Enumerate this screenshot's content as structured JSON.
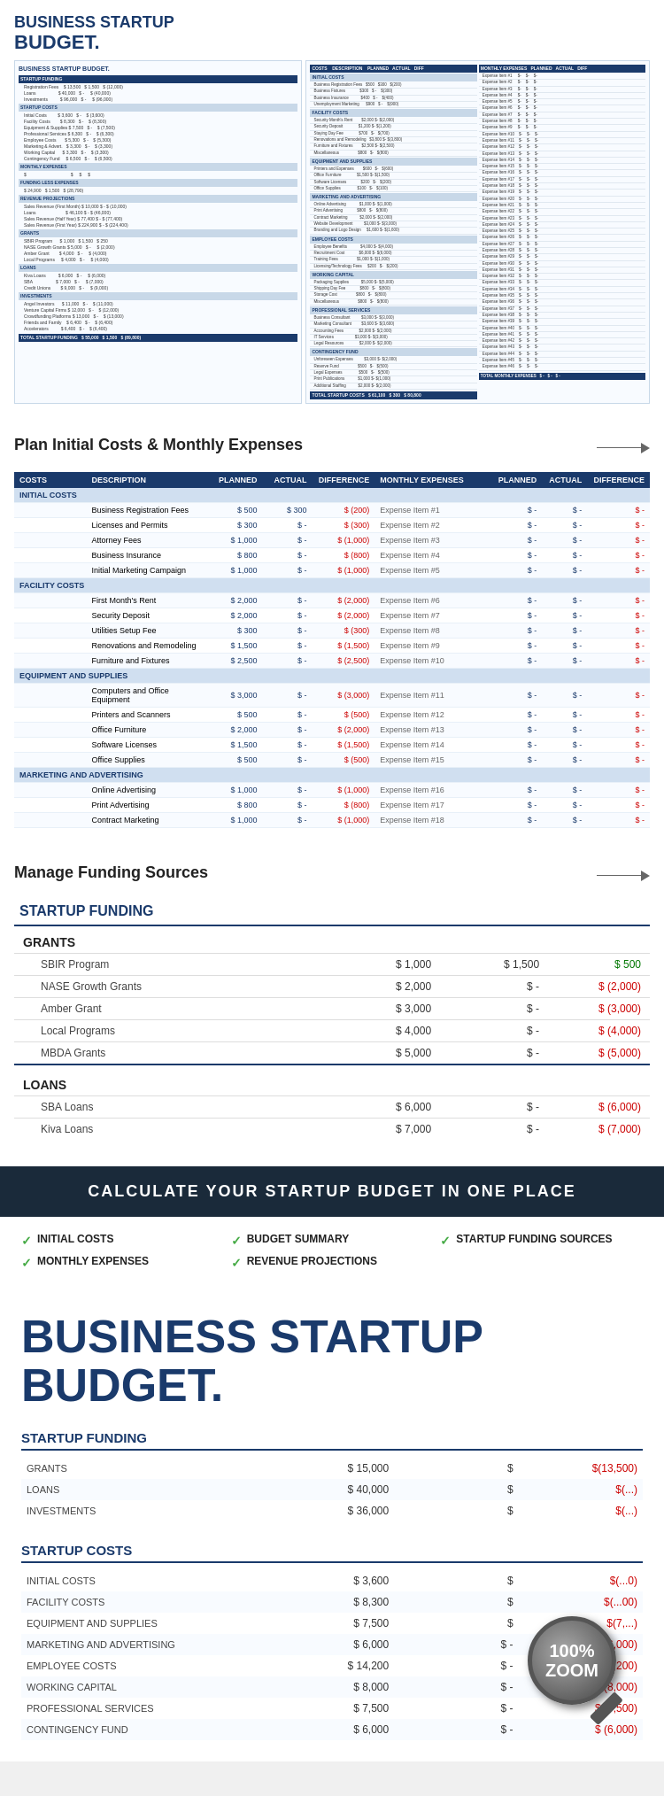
{
  "header": {
    "title": "BUSINESS STARTUP",
    "title2": "BUDGET."
  },
  "transition1": {
    "text": "Plan Initial Costs & Monthly Expenses"
  },
  "transition2": {
    "text": "Manage Funding Sources"
  },
  "banner": {
    "text": "CALCULATE YOUR STARTUP BUDGET IN ONE PLACE"
  },
  "features": [
    {
      "label": "INITIAL COSTS"
    },
    {
      "label": "MONTHLY EXPENSES"
    },
    {
      "label": "BUDGET SUMMARY"
    },
    {
      "label": "REVENUE PROJECTIONS"
    },
    {
      "label": "STARTUP FUNDING SOURCES"
    }
  ],
  "spreadsheet": {
    "sections": {
      "startup_funding": "STARTUP FUNDING",
      "startup_costs": "STARTUP COSTS",
      "monthly_expenses": "MONTHLY EXPENSES",
      "funding_less_expenses": "FUNDING LESS EXPENSES",
      "revenue_projections": "REVENUE PROJECTIONS",
      "grants": "GRANTS",
      "loans": "LOANS",
      "investments": "INVESTMENTS",
      "total": "TOTAL STARTUP FUNDING"
    }
  },
  "detail_table": {
    "headers": [
      "COSTS",
      "DESCRIPTION",
      "PLANNED",
      "ACTUAL",
      "DIFFERENCE",
      "MONTHLY EXPENSES",
      "PLANNED",
      "ACTUAL",
      "DIFFERENCE"
    ],
    "initial_costs": [
      {
        "item": "Business Registration Fees",
        "planned": "$ 500",
        "actual": "$ 300",
        "diff": "$ (200)",
        "exp": "Expense Item #1",
        "ep": "$",
        "ea": "$",
        "ed": "$"
      },
      {
        "item": "Licenses and Permits",
        "planned": "$ 300",
        "actual": "$  -",
        "diff": "$ (300)",
        "exp": "Expense Item #2",
        "ep": "$",
        "ea": "$",
        "ed": "$"
      },
      {
        "item": "Attorney Fees",
        "planned": "$ 1,000",
        "actual": "$  -",
        "diff": "$ (1,000)",
        "exp": "Expense Item #3",
        "ep": "$",
        "ea": "$",
        "ed": "$"
      },
      {
        "item": "Business Insurance",
        "planned": "$ 800",
        "actual": "$  -",
        "diff": "$ (800)",
        "exp": "Expense Item #4",
        "ep": "$",
        "ea": "$",
        "ed": "$"
      },
      {
        "item": "Initial Marketing Campaign",
        "planned": "$ 1,000",
        "actual": "$  -",
        "diff": "$ (1,000)",
        "exp": "Expense Item #5",
        "ep": "$",
        "ea": "$",
        "ed": "$"
      }
    ],
    "facility_costs": [
      {
        "item": "First Month's Rent",
        "planned": "$ 2,000",
        "actual": "$  -",
        "diff": "$ (2,000)",
        "exp": "Expense Item #6",
        "ep": "$",
        "ea": "$",
        "ed": "$"
      },
      {
        "item": "Security Deposit",
        "planned": "$ 2,000",
        "actual": "$  -",
        "diff": "$ (2,000)",
        "exp": "Expense Item #7",
        "ep": "$",
        "ea": "$",
        "ed": "$"
      },
      {
        "item": "Utilities Setup Fee",
        "planned": "$ 300",
        "actual": "$  -",
        "diff": "$ (300)",
        "exp": "Expense Item #8",
        "ep": "$",
        "ea": "$",
        "ed": "$"
      },
      {
        "item": "Renovations and Remodeling",
        "planned": "$ 1,500",
        "actual": "$  -",
        "diff": "$ (1,500)",
        "exp": "Expense Item #9",
        "ep": "$",
        "ea": "$",
        "ed": "$"
      },
      {
        "item": "Furniture and Fixtures",
        "planned": "$ 2,500",
        "actual": "$  -",
        "diff": "$ (2,500)",
        "exp": "Expense Item #10",
        "ep": "$",
        "ea": "$",
        "ed": "$"
      }
    ],
    "equipment_supplies": [
      {
        "item": "Computers and Office Equipment",
        "planned": "$ 3,000",
        "actual": "$  -",
        "diff": "$ (3,000)",
        "exp": "Expense Item #11",
        "ep": "$",
        "ea": "$",
        "ed": "$"
      },
      {
        "item": "Printers and Scanners",
        "planned": "$ 500",
        "actual": "$  -",
        "diff": "$ (500)",
        "exp": "Expense Item #12",
        "ep": "$",
        "ea": "$",
        "ed": "$"
      },
      {
        "item": "Office Furniture",
        "planned": "$ 2,000",
        "actual": "$  -",
        "diff": "$ (2,000)",
        "exp": "Expense Item #13",
        "ep": "$",
        "ea": "$",
        "ed": "$"
      },
      {
        "item": "Software Licenses",
        "planned": "$ 1,500",
        "actual": "$  -",
        "diff": "$ (1,500)",
        "exp": "Expense Item #14",
        "ep": "$",
        "ea": "$",
        "ed": "$"
      },
      {
        "item": "Office Supplies",
        "planned": "$ 500",
        "actual": "$  -",
        "diff": "$ (500)",
        "exp": "Expense Item #15",
        "ep": "$",
        "ea": "$",
        "ed": "$"
      }
    ],
    "marketing": [
      {
        "item": "Online Advertising",
        "planned": "$ 1,000",
        "actual": "$  -",
        "diff": "$ (1,000)",
        "exp": "Expense Item #16",
        "ep": "$",
        "ea": "$",
        "ed": "$"
      },
      {
        "item": "...",
        "planned": "$ 1,000",
        "actual": "$  -",
        "diff": "$ (1,000)",
        "exp": "Expense Item #17",
        "ep": "$",
        "ea": "$",
        "ed": "$"
      },
      {
        "item": "...",
        "planned": "$ 1,000",
        "actual": "$  -",
        "diff": "$ (1,000)",
        "exp": "Expense Item #18",
        "ep": "$",
        "ea": "$",
        "ed": "$"
      }
    ]
  },
  "funding_table": {
    "main_header": "STARTUP FUNDING",
    "grants_header": "GRANTS",
    "loans_header": "LOANS",
    "grants": [
      {
        "label": "SBIR Program",
        "planned": "$ 1,000",
        "actual": "$ 1,500",
        "diff": "$ 500"
      },
      {
        "label": "NASE Growth Grants",
        "planned": "$ 2,000",
        "actual": "$  -",
        "diff": "$ (2,000)"
      },
      {
        "label": "Amber Grant",
        "planned": "$ 3,000",
        "actual": "$  -",
        "diff": "$ (3,000)"
      },
      {
        "label": "Local Programs",
        "planned": "$ 4,000",
        "actual": "$  -",
        "diff": "$ (4,000)"
      },
      {
        "label": "MBDA Grants",
        "planned": "$ 5,000",
        "actual": "$  -",
        "diff": "$ (5,000)"
      }
    ],
    "loans": [
      {
        "label": "SBA Loans",
        "planned": "$ 6,000",
        "actual": "$  -",
        "diff": "$ (6,000)"
      },
      {
        "label": "Kiva Loans",
        "planned": "$ 7,000",
        "actual": "$  -",
        "diff": "$ (7,000)"
      }
    ]
  },
  "large_view": {
    "title1": "BUSINESS STARTUP",
    "title2": "BUDGET.",
    "startup_funding_header": "STARTUP FUNDING",
    "startup_costs_header": "STARTUP COSTS",
    "funding_rows": [
      {
        "label": "GRANTS",
        "planned": "$ 15,000",
        "actual": "$",
        "diff": "$(13,500)"
      },
      {
        "label": "LOANS",
        "planned": "$ 40,000",
        "actual": "$",
        "diff": "$(...)"
      },
      {
        "label": "INVESTMENTS",
        "planned": "$ 36,000",
        "actual": "$",
        "diff": "$(...)"
      }
    ],
    "costs_rows": [
      {
        "label": "INITIAL COSTS",
        "planned": "$ 3,600",
        "actual": "$",
        "diff": "$(...0)"
      },
      {
        "label": "FACILITY COSTS",
        "planned": "$ 8,300",
        "actual": "$",
        "diff": "$(...00)"
      },
      {
        "label": "EQUIPMENT AND SUPPLIES",
        "planned": "$ 7,500",
        "actual": "$",
        "diff": "$(7,...)"
      },
      {
        "label": "MARKETING AND ADVERTISING",
        "planned": "$ 6,000",
        "actual": "$ -",
        "diff": "$ (6,000)"
      },
      {
        "label": "EMPLOYEE COSTS",
        "planned": "$ 14,200",
        "actual": "$ -",
        "diff": "$ (14,200)"
      },
      {
        "label": "WORKING CAPITAL",
        "planned": "$ 8,000",
        "actual": "$ -",
        "diff": "$ (8,000)"
      },
      {
        "label": "PROFESSIONAL SERVICES",
        "planned": "$ 7,500",
        "actual": "$ -",
        "diff": "$ (7,500)"
      },
      {
        "label": "CONTINGENCY FUND",
        "planned": "$ 6,000",
        "actual": "$ -",
        "diff": "$ (6,000)"
      }
    ],
    "magnifier_text": "100%\nZOOM"
  }
}
